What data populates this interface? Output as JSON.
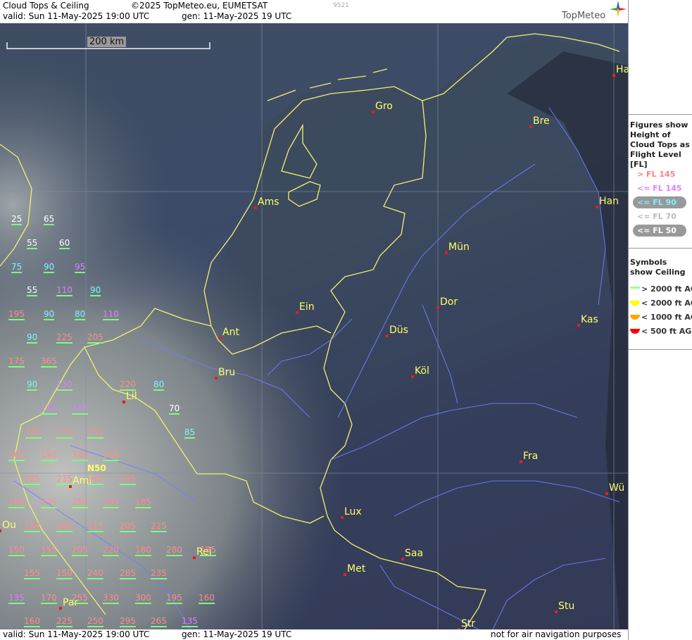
{
  "header": {
    "title": "Cloud Tops & Ceiling",
    "copyright": "©2025 TopMeteo.eu, EUMETSAT",
    "code": "9521",
    "valid": "valid:  Sun  11-May-2025  19:00 UTC",
    "gen": "gen: 11-May-2025 19 UTC",
    "logo_text": "TopMeteo"
  },
  "footer": {
    "valid": "valid:  Sun  11-May-2025  19:00 UTC",
    "gen": "gen: 11-May-2025 19 UTC",
    "note": "not for air navigation purposes"
  },
  "scale": {
    "label": "200 km"
  },
  "grid_label": "N50",
  "legend": {
    "tops_title": "Figures show Height of Cloud Tops as Flight Level  [FL]",
    "tops": [
      {
        "label": "> FL 145",
        "color": "#ff7f7f"
      },
      {
        "label": "<= FL 145",
        "color": "#e27cff"
      },
      {
        "label": "<= FL 90",
        "color": "#7df2ff"
      },
      {
        "label": "<= FL 70",
        "color": "#bbbbbb"
      },
      {
        "label": "<= FL 50",
        "color": "#ffffff"
      }
    ],
    "ceiling_title": "Symbols show Ceiling",
    "ceiling": [
      {
        "label": "> 2000 ft AGL",
        "color": "#9cff9c"
      },
      {
        "label": "< 2000 ft AGL",
        "color": "#ffff00"
      },
      {
        "label": "< 1000 ft AGL",
        "color": "#ffa500"
      },
      {
        "label": "< 500 ft AGL",
        "color": "#ff0000"
      }
    ]
  },
  "cities": [
    {
      "name": "Ha"
    },
    {
      "name": "Gro"
    },
    {
      "name": "Bre"
    },
    {
      "name": "Ams"
    },
    {
      "name": "Han"
    },
    {
      "name": "Mün"
    },
    {
      "name": "Ein"
    },
    {
      "name": "Dor"
    },
    {
      "name": "Ant"
    },
    {
      "name": "Düs"
    },
    {
      "name": "Kas"
    },
    {
      "name": "Bru"
    },
    {
      "name": "Köl"
    },
    {
      "name": "Lil"
    },
    {
      "name": "Fra"
    },
    {
      "name": "Ami"
    },
    {
      "name": "Wü"
    },
    {
      "name": "Lux"
    },
    {
      "name": "Saa"
    },
    {
      "name": "Met"
    },
    {
      "name": "Stu"
    },
    {
      "name": "Par"
    },
    {
      "name": "Str"
    },
    {
      "name": "Ou"
    },
    {
      "name": "Rei"
    }
  ],
  "cloud_tops": [
    {
      "v": "25",
      "c": "c-wh"
    },
    {
      "v": "65",
      "c": "c-wh"
    },
    {
      "v": "55",
      "c": "c-wh"
    },
    {
      "v": "60",
      "c": "c-wh"
    },
    {
      "v": "75",
      "c": "c-cy"
    },
    {
      "v": "90",
      "c": "c-cy"
    },
    {
      "v": "95",
      "c": "c-mag"
    },
    {
      "v": "55",
      "c": "c-wh"
    },
    {
      "v": "110",
      "c": "c-mag"
    },
    {
      "v": "90",
      "c": "c-cy"
    },
    {
      "v": "195",
      "c": "c-red"
    },
    {
      "v": "90",
      "c": "c-cy"
    },
    {
      "v": "80",
      "c": "c-cy"
    },
    {
      "v": "110",
      "c": "c-mag"
    },
    {
      "v": "90",
      "c": "c-cy"
    },
    {
      "v": "225",
      "c": "c-red"
    },
    {
      "v": "205",
      "c": "c-red"
    },
    {
      "v": "175",
      "c": "c-red"
    },
    {
      "v": "365",
      "c": "c-red"
    },
    {
      "v": "90",
      "c": "c-cy"
    },
    {
      "v": "130",
      "c": "c-mag"
    },
    {
      "v": "220",
      "c": "c-red"
    },
    {
      "v": "80",
      "c": "c-cy"
    },
    {
      "v": "110",
      "c": "c-mag"
    },
    {
      "v": "115",
      "c": "c-mag"
    },
    {
      "v": "70",
      "c": "c-wh"
    },
    {
      "v": "165",
      "c": "c-red"
    },
    {
      "v": "175",
      "c": "c-red"
    },
    {
      "v": "150",
      "c": "c-red"
    },
    {
      "v": "85",
      "c": "c-cy"
    },
    {
      "v": "265",
      "c": "c-red"
    },
    {
      "v": "195",
      "c": "c-red"
    },
    {
      "v": "180",
      "c": "c-red"
    },
    {
      "v": "150",
      "c": "c-red"
    },
    {
      "v": "185",
      "c": "c-red"
    },
    {
      "v": "235",
      "c": "c-red"
    },
    {
      "v": "245",
      "c": "c-red"
    },
    {
      "v": "195",
      "c": "c-red"
    },
    {
      "v": "160",
      "c": "c-red"
    },
    {
      "v": "235",
      "c": "c-red"
    },
    {
      "v": "250",
      "c": "c-red"
    },
    {
      "v": "235",
      "c": "c-red"
    },
    {
      "v": "185",
      "c": "c-red"
    },
    {
      "v": "150",
      "c": "c-red"
    },
    {
      "v": "185",
      "c": "c-red"
    },
    {
      "v": "215",
      "c": "c-red"
    },
    {
      "v": "205",
      "c": "c-red"
    },
    {
      "v": "225",
      "c": "c-red"
    },
    {
      "v": "150",
      "c": "c-red"
    },
    {
      "v": "155",
      "c": "c-red"
    },
    {
      "v": "205",
      "c": "c-red"
    },
    {
      "v": "220",
      "c": "c-red"
    },
    {
      "v": "180",
      "c": "c-red"
    },
    {
      "v": "280",
      "c": "c-red"
    },
    {
      "v": "185",
      "c": "c-red"
    },
    {
      "v": "155",
      "c": "c-red"
    },
    {
      "v": "150",
      "c": "c-red"
    },
    {
      "v": "240",
      "c": "c-red"
    },
    {
      "v": "285",
      "c": "c-red"
    },
    {
      "v": "235",
      "c": "c-red"
    },
    {
      "v": "135",
      "c": "c-mag"
    },
    {
      "v": "170",
      "c": "c-red"
    },
    {
      "v": "255",
      "c": "c-red"
    },
    {
      "v": "330",
      "c": "c-red"
    },
    {
      "v": "300",
      "c": "c-red"
    },
    {
      "v": "195",
      "c": "c-red"
    },
    {
      "v": "160",
      "c": "c-red"
    },
    {
      "v": "160",
      "c": "c-red"
    },
    {
      "v": "225",
      "c": "c-red"
    },
    {
      "v": "250",
      "c": "c-red"
    },
    {
      "v": "295",
      "c": "c-red"
    },
    {
      "v": "265",
      "c": "c-red"
    },
    {
      "v": "135",
      "c": "c-mag"
    }
  ]
}
